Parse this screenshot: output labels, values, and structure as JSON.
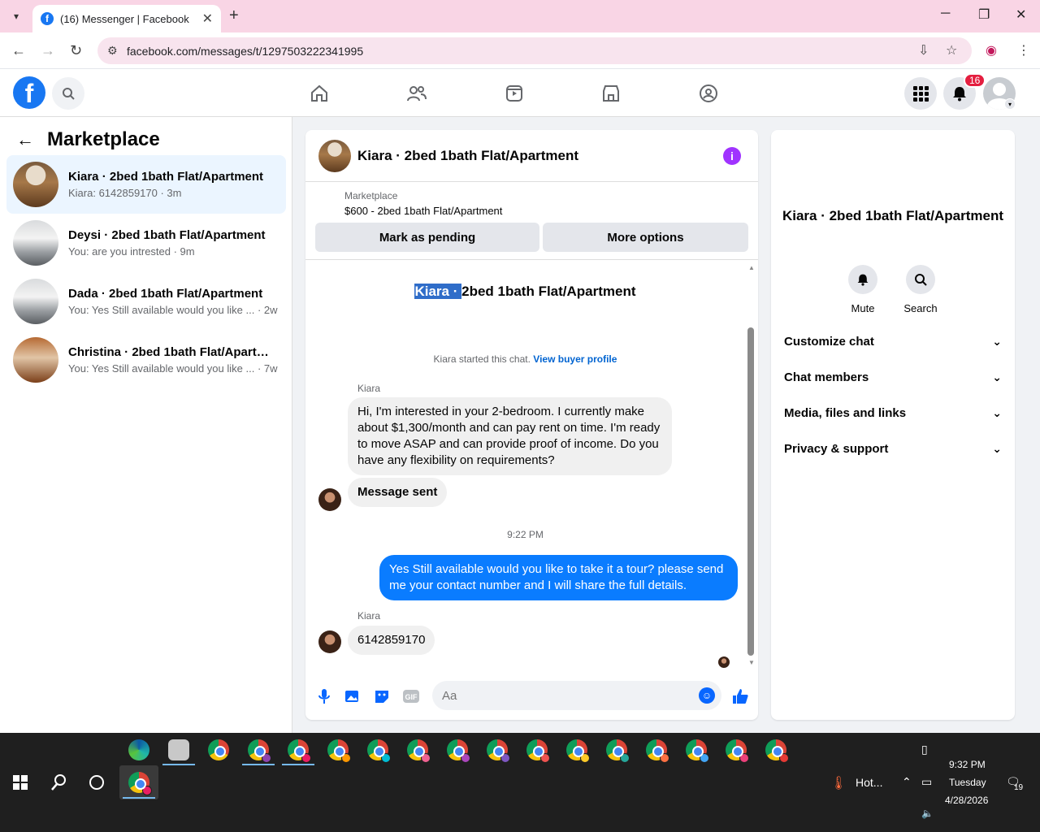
{
  "browser": {
    "tab_title": "(16) Messenger | Facebook",
    "url": "facebook.com/messages/t/1297503222341995",
    "new_tab": "+",
    "close_tab": "✕"
  },
  "fb": {
    "notification_count": "16",
    "logo": "f"
  },
  "sidebar": {
    "title": "Marketplace",
    "conversations": [
      {
        "name": "Kiara · 2bed 1bath Flat/Apartment",
        "preview": "Kiara: 6142859170 · 3m",
        "active": true
      },
      {
        "name": "Deysi · 2bed 1bath Flat/Apartment",
        "preview": "You: are you intrested · 9m"
      },
      {
        "name": "Dada · 2bed 1bath Flat/Apartment",
        "preview": "You: Yes Still available would you like ... · 2w"
      },
      {
        "name": "Christina · 2bed 1bath Flat/Apartm...",
        "preview": "You: Yes Still available would you like ... · 7w"
      }
    ]
  },
  "chat": {
    "header_title": "Kiara · 2bed 1bath Flat/Apartment",
    "marketplace_label": "Marketplace",
    "listing": "$600 - 2bed 1bath Flat/Apartment",
    "mark_pending": "Mark as pending",
    "more_options": "More options",
    "conv_title_selected": "Kiara · ",
    "conv_title_rest": "2bed 1bath Flat/Apartment",
    "started_text": "Kiara started this chat.",
    "view_buyer_profile": "View buyer profile",
    "messages": [
      {
        "sender": "Kiara",
        "text": "Hi, I'm interested in your 2-bedroom. I currently make about $1,300/month and can pay rent on time. I'm ready to move ASAP and can provide proof of income. Do you have any flexibility on requirements?"
      },
      {
        "text": "Message sent"
      },
      {
        "timestamp": "9:22 PM"
      },
      {
        "outgoing": true,
        "text": "Yes Still available would you like to take it a tour? please send me your contact number and I will share the full details."
      },
      {
        "sender": "Kiara",
        "text": "6142859170"
      }
    ],
    "input_placeholder": "Aa"
  },
  "right_panel": {
    "name": "Kiara · 2bed 1bath Flat/Apartment",
    "mute": "Mute",
    "search": "Search",
    "sections": [
      "Customize chat",
      "Chat members",
      "Media, files and links",
      "Privacy & support"
    ]
  },
  "taskbar": {
    "weather": "Hot...",
    "time": "9:32 PM",
    "day": "Tuesday",
    "date": "4/28/2026",
    "notif_count": "19"
  }
}
